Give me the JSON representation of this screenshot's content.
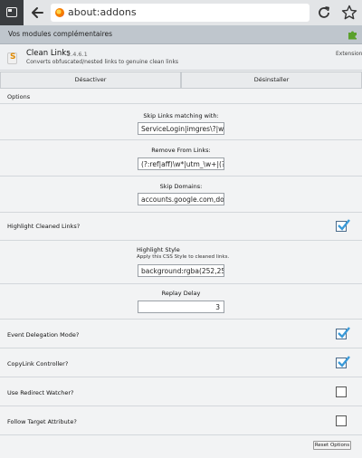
{
  "browser": {
    "url": "about:addons"
  },
  "page": {
    "title": "Vos modules complémentaires"
  },
  "addon": {
    "name": "Clean Links",
    "version": "2.4.6.1",
    "description": "Converts obfuscated/nested links to genuine clean links",
    "type": "Extension",
    "disable_label": "Désactiver",
    "uninstall_label": "Désinstaller"
  },
  "options": {
    "header": "Options",
    "skip_links": {
      "label": "Skip Links matching with:",
      "value": "ServiceLogin|imgres\\?|watc"
    },
    "remove_from_links": {
      "label": "Remove From Links:",
      "value": "(?:ref|aff)\\w*|utm_\\w+|(?:m"
    },
    "skip_domains": {
      "label": "Skip Domains:",
      "value": "accounts.google.com,docs"
    },
    "highlight_cleaned": {
      "label": "Highlight Cleaned Links?",
      "checked": true
    },
    "highlight_style": {
      "label": "Highlight Style",
      "sub": "Apply this CSS Style to cleaned links.",
      "value": "background:rgba(252,252,0"
    },
    "replay_delay": {
      "label": "Replay Delay",
      "value": "3"
    },
    "event_delegation": {
      "label": "Event Delegation Mode?",
      "checked": true
    },
    "copylink_controller": {
      "label": "CopyLink Controller?",
      "checked": true
    },
    "redirect_watcher": {
      "label": "Use Redirect Watcher?",
      "checked": false
    },
    "follow_target": {
      "label": "Follow Target Attribute?",
      "checked": false
    },
    "reset_label": "Reset Options"
  },
  "colors": {
    "accent": "#4a6a8a",
    "title_bar": "#bfc6cd",
    "background": "#f2f3f4"
  }
}
